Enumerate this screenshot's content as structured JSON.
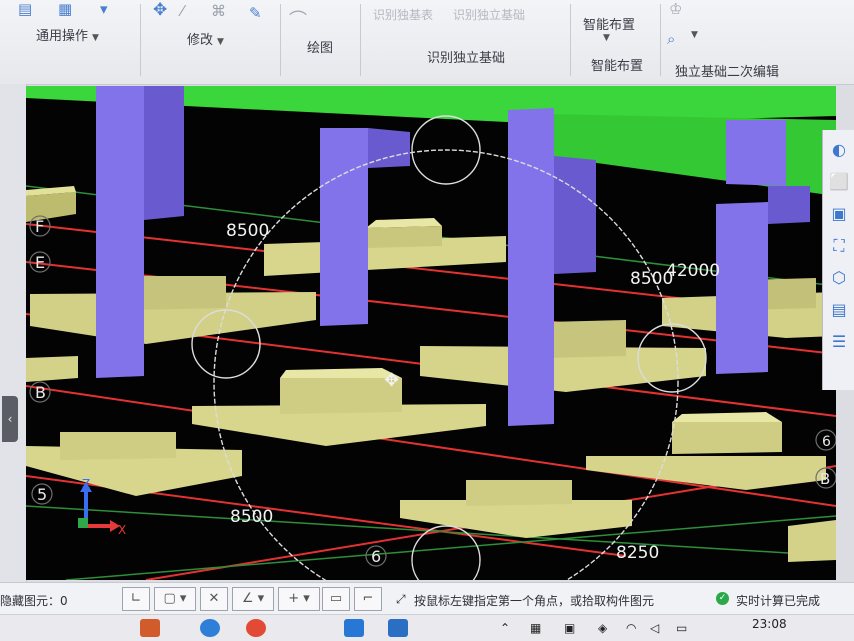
{
  "ribbon": {
    "groups": {
      "general_ops": "通用操作",
      "modify": "修改",
      "draw": "绘图",
      "identify": "识别独立基础",
      "smart_layout_btn": "智能布置",
      "smart_layout": "智能布置",
      "secondary_edit": "独立基础二次编辑"
    },
    "faded_buttons": [
      "识别独基表",
      "识别独立基础"
    ]
  },
  "viewport": {
    "axis_labels": [
      "F",
      "E",
      "B",
      "5",
      "6",
      "6",
      "B"
    ],
    "dimensions": [
      "8500",
      "8500",
      "42000",
      "8500",
      "8250"
    ],
    "colors": {
      "background": "#030303",
      "foundation": "#d8d68c",
      "column": "#8373ea",
      "beam": "#3bd63b",
      "axis_red": "#e43232",
      "axis_green": "#2e8f3a"
    },
    "gizmo": {
      "z": "Z",
      "x": "X"
    }
  },
  "status": {
    "hidden_elements": "隐藏图元：0",
    "prompt": "按鼠标左键指定第一个角点，或拾取构件图元",
    "realtime": "实时计算已完成"
  },
  "taskbar": {
    "time": "23:08"
  },
  "icons": [
    "move-icon",
    "cube-icon",
    "zoom-icon",
    "axis-gizmo-icon",
    "check-circle-icon"
  ]
}
